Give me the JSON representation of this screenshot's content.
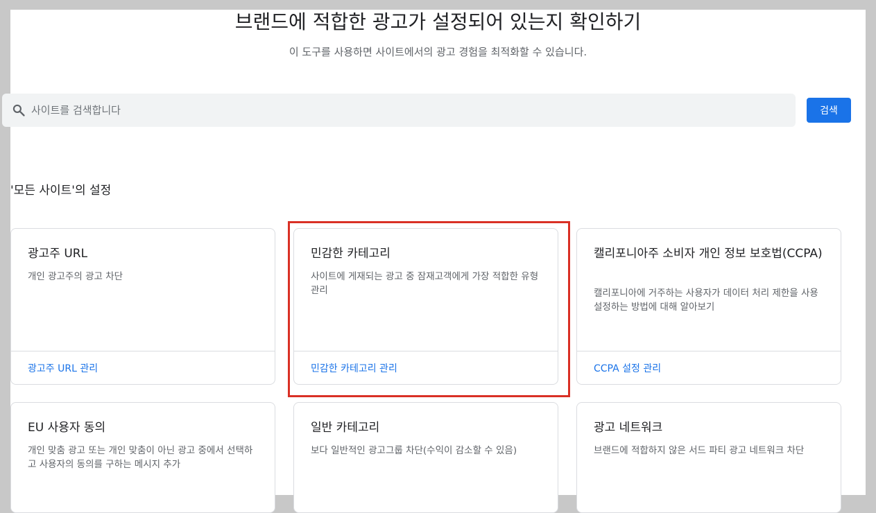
{
  "header": {
    "title": "브랜드에 적합한 광고가 설정되어 있는지 확인하기",
    "subtitle": "이 도구를 사용하면 사이트에서의 광고 경험을 최적화할 수 있습니다."
  },
  "search": {
    "placeholder": "사이트를 검색합니다",
    "button_label": "검색"
  },
  "section": {
    "title": "'모든 사이트'의 설정"
  },
  "cards": [
    {
      "title": "광고주 URL",
      "description": "개인 광고주의 광고 차단",
      "link": "광고주 URL 관리"
    },
    {
      "title": "민감한 카테고리",
      "description": "사이트에 게재되는 광고 중 잠재고객에게 가장 적합한 유형 관리",
      "link": "민감한 카테고리 관리"
    },
    {
      "title": "캘리포니아주 소비자 개인 정보 보호법(CCPA)",
      "description": "캘리포니아에 거주하는 사용자가 데이터 처리 제한을 사용 설정하는 방법에 대해 알아보기",
      "link": "CCPA 설정 관리"
    },
    {
      "title": "EU 사용자 동의",
      "description": "개인 맞춤 광고 또는 개인 맞춤이 아닌 광고 중에서 선택하고 사용자의 동의를 구하는 메시지 추가"
    },
    {
      "title": "일반 카테고리",
      "description": "보다 일반적인 광고그룹 차단(수익이 감소할 수 있음)"
    },
    {
      "title": "광고 네트워크",
      "description": "브랜드에 적합하지 않은 서드 파티 광고 네트워크 차단"
    }
  ],
  "colors": {
    "accent": "#1a73e8",
    "highlight": "#d93025"
  }
}
